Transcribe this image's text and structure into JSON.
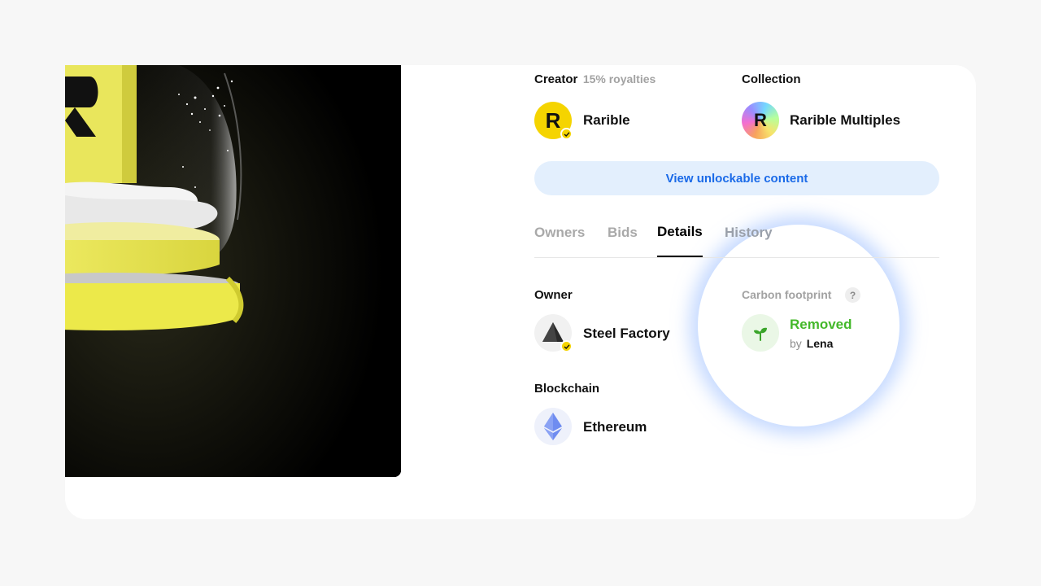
{
  "creator": {
    "label": "Creator",
    "royalties": "15% royalties",
    "name": "Rarible",
    "avatar_letter": "R"
  },
  "collection": {
    "label": "Collection",
    "name": "Rarible Multiples",
    "avatar_letter": "R"
  },
  "unlockable_button": "View unlockable content",
  "tabs": [
    {
      "label": "Owners",
      "active": false
    },
    {
      "label": "Bids",
      "active": false
    },
    {
      "label": "Details",
      "active": true
    },
    {
      "label": "History",
      "active": false
    }
  ],
  "owner": {
    "label": "Owner",
    "name": "Steel Factory"
  },
  "carbon": {
    "label": "Carbon footprint",
    "help": "?",
    "status": "Removed",
    "by_prefix": "by",
    "by_name": "Lena"
  },
  "blockchain": {
    "label": "Blockchain",
    "name": "Ethereum"
  },
  "colors": {
    "accent_blue": "#1a6ae8",
    "button_bg": "#e3effd",
    "verified_yellow": "#f5d400",
    "carbon_green": "#44b82a"
  }
}
